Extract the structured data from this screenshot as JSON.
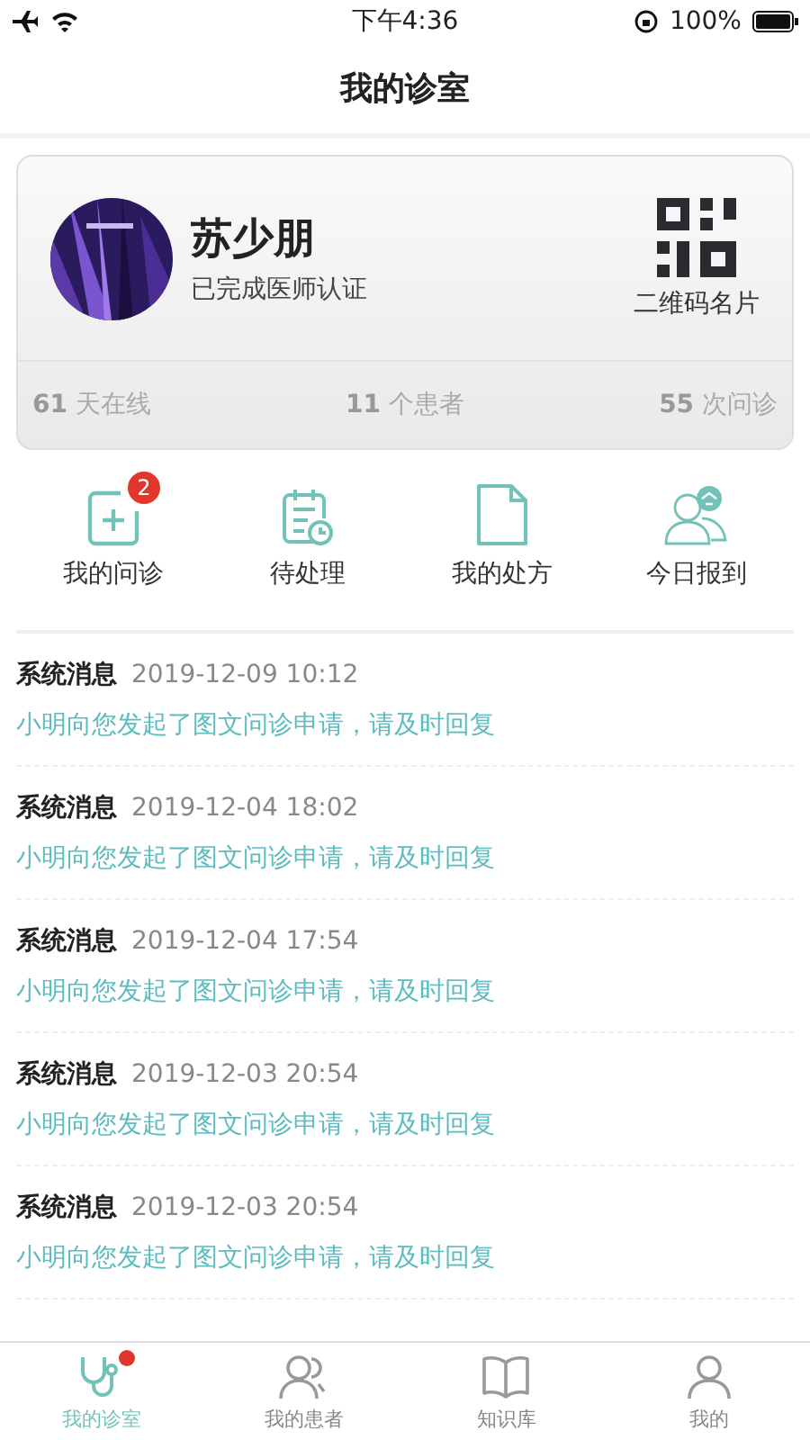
{
  "status_bar": {
    "time": "下午4:36",
    "battery": "100%"
  },
  "header": {
    "title": "我的诊室"
  },
  "profile": {
    "name": "苏少朋",
    "status": "已完成医师认证",
    "qr_label": "二维码名片",
    "stats": [
      {
        "value": "61",
        "label": "天在线"
      },
      {
        "value": "11",
        "label": "个患者"
      },
      {
        "value": "55",
        "label": "次问诊"
      }
    ]
  },
  "shortcuts": [
    {
      "label": "我的问诊",
      "kind": "consult",
      "badge": "2"
    },
    {
      "label": "待处理",
      "kind": "pending"
    },
    {
      "label": "我的处方",
      "kind": "prescription"
    },
    {
      "label": "今日报到",
      "kind": "checkin"
    }
  ],
  "messages": [
    {
      "title": "系统消息",
      "time": "2019-12-09 10:12",
      "body": "小明向您发起了图文问诊申请，请及时回复"
    },
    {
      "title": "系统消息",
      "time": "2019-12-04 18:02",
      "body": "小明向您发起了图文问诊申请，请及时回复"
    },
    {
      "title": "系统消息",
      "time": "2019-12-04 17:54",
      "body": "小明向您发起了图文问诊申请，请及时回复"
    },
    {
      "title": "系统消息",
      "time": "2019-12-03 20:54",
      "body": "小明向您发起了图文问诊申请，请及时回复"
    },
    {
      "title": "系统消息",
      "time": "2019-12-03 20:54",
      "body": "小明向您发起了图文问诊申请，请及时回复"
    }
  ],
  "tabs": [
    {
      "label": "我的诊室",
      "kind": "clinic",
      "selected": true,
      "dot": true
    },
    {
      "label": "我的患者",
      "kind": "patients",
      "selected": false,
      "dot": false
    },
    {
      "label": "知识库",
      "kind": "library",
      "selected": false,
      "dot": false
    },
    {
      "label": "我的",
      "kind": "me",
      "selected": false,
      "dot": false
    }
  ]
}
